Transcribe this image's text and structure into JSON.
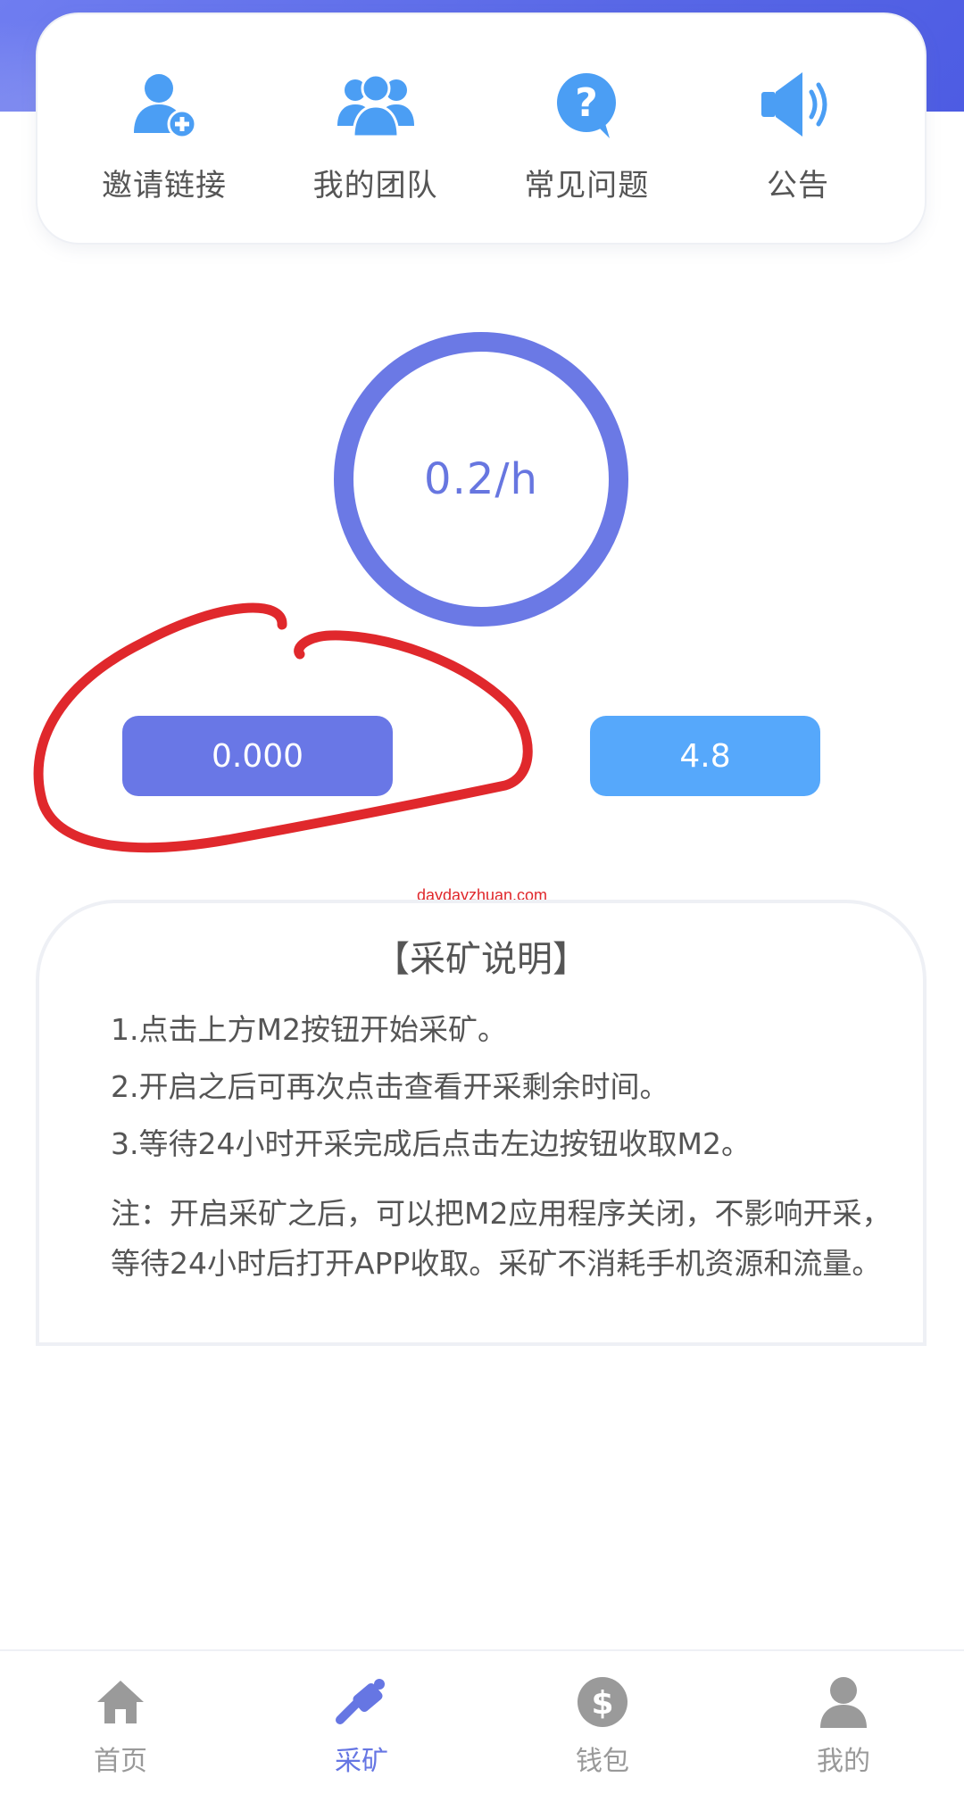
{
  "quick_actions": [
    {
      "label": "邀请链接",
      "icon": "add-user-icon"
    },
    {
      "label": "我的团队",
      "icon": "team-icon"
    },
    {
      "label": "常见问题",
      "icon": "question-icon"
    },
    {
      "label": "公告",
      "icon": "speaker-icon"
    }
  ],
  "mining": {
    "rate": "0.2/h",
    "collect_value": "0.000",
    "balance_value": "4.8"
  },
  "watermark": "daydayzhuan.com",
  "instructions": {
    "title": "【采矿说明】",
    "steps": [
      "1.点击上方M2按钮开始采矿。",
      "2.开启之后可再次点击查看开采剩余时间。",
      "3.等待24小时开采完成后点击左边按钮收取M2。"
    ],
    "note": "注：开启采矿之后，可以把M2应用程序关闭，不影响开采，等待24小时后打开APP收取。采矿不消耗手机资源和流量。"
  },
  "bottom_nav": [
    {
      "label": "首页",
      "icon": "home-icon",
      "active": false
    },
    {
      "label": "采矿",
      "icon": "mining-icon",
      "active": true
    },
    {
      "label": "钱包",
      "icon": "wallet-dollar-icon",
      "active": false
    },
    {
      "label": "我的",
      "icon": "profile-icon",
      "active": false
    }
  ],
  "colors": {
    "primary": "#6b79e5",
    "icon_blue": "#4b9ef4",
    "balance_button": "#56a8fb",
    "nav_inactive": "#9a9a9a",
    "annotation_red": "#e0282c"
  }
}
